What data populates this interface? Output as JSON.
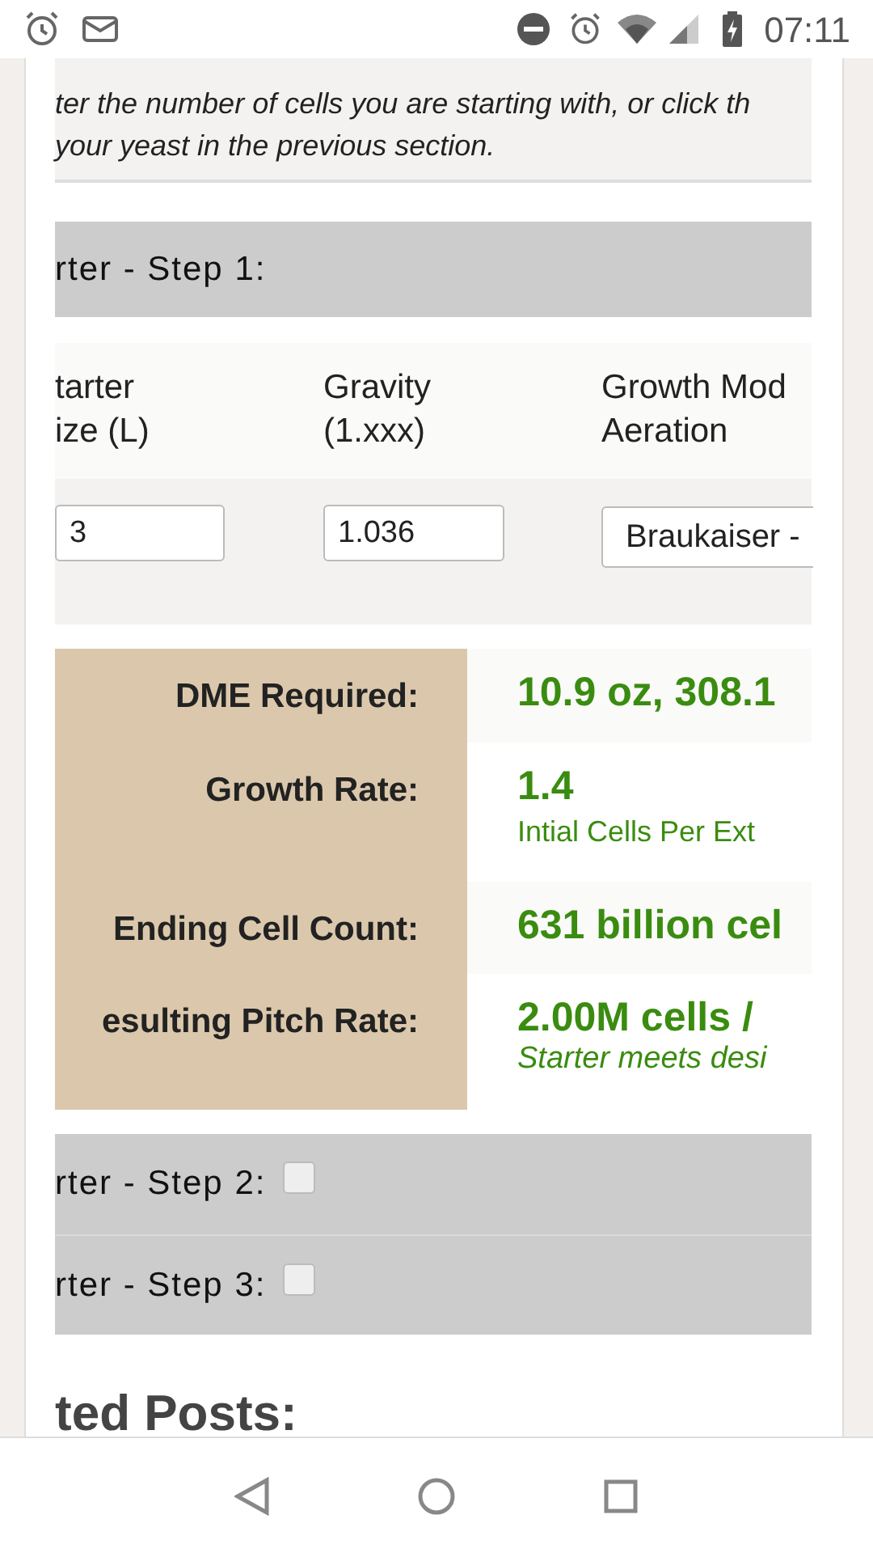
{
  "status_bar": {
    "time": "07:11"
  },
  "intro": {
    "lines": [
      "ter the number of cells you are starting with, or click th",
      "your yeast in the previous section."
    ]
  },
  "step_1": {
    "title": "rter - Step 1:",
    "columns": [
      {
        "lines": [
          "tarter",
          "ize (L)"
        ]
      },
      {
        "lines": [
          "Gravity",
          "(1.xxx)"
        ]
      },
      {
        "lines": [
          "Growth Mod",
          "Aeration"
        ]
      }
    ],
    "fields": [
      {
        "kind": "input",
        "value": "3"
      },
      {
        "kind": "input",
        "value": "1.036"
      },
      {
        "kind": "select",
        "value": "Braukaiser -"
      }
    ]
  },
  "results": [
    {
      "label": "DME Required:",
      "value": "10.9 oz, 308.1"
    },
    {
      "label": "Growth Rate:",
      "value": "1.4",
      "note": {
        "text": "Intial Cells Per Ext",
        "italic": false
      }
    },
    {
      "label": "Ending Cell Count:",
      "value": "631 billion cel"
    },
    {
      "label": "esulting Pitch Rate:",
      "value": "2.00M cells / ",
      "note": {
        "text": "Starter meets desi",
        "italic": true
      }
    }
  ],
  "more_steps": [
    {
      "title": "rter - Step 2:",
      "checked": false
    },
    {
      "title": "rter - Step 3:",
      "checked": false
    }
  ],
  "related_heading": "ted Posts:"
}
